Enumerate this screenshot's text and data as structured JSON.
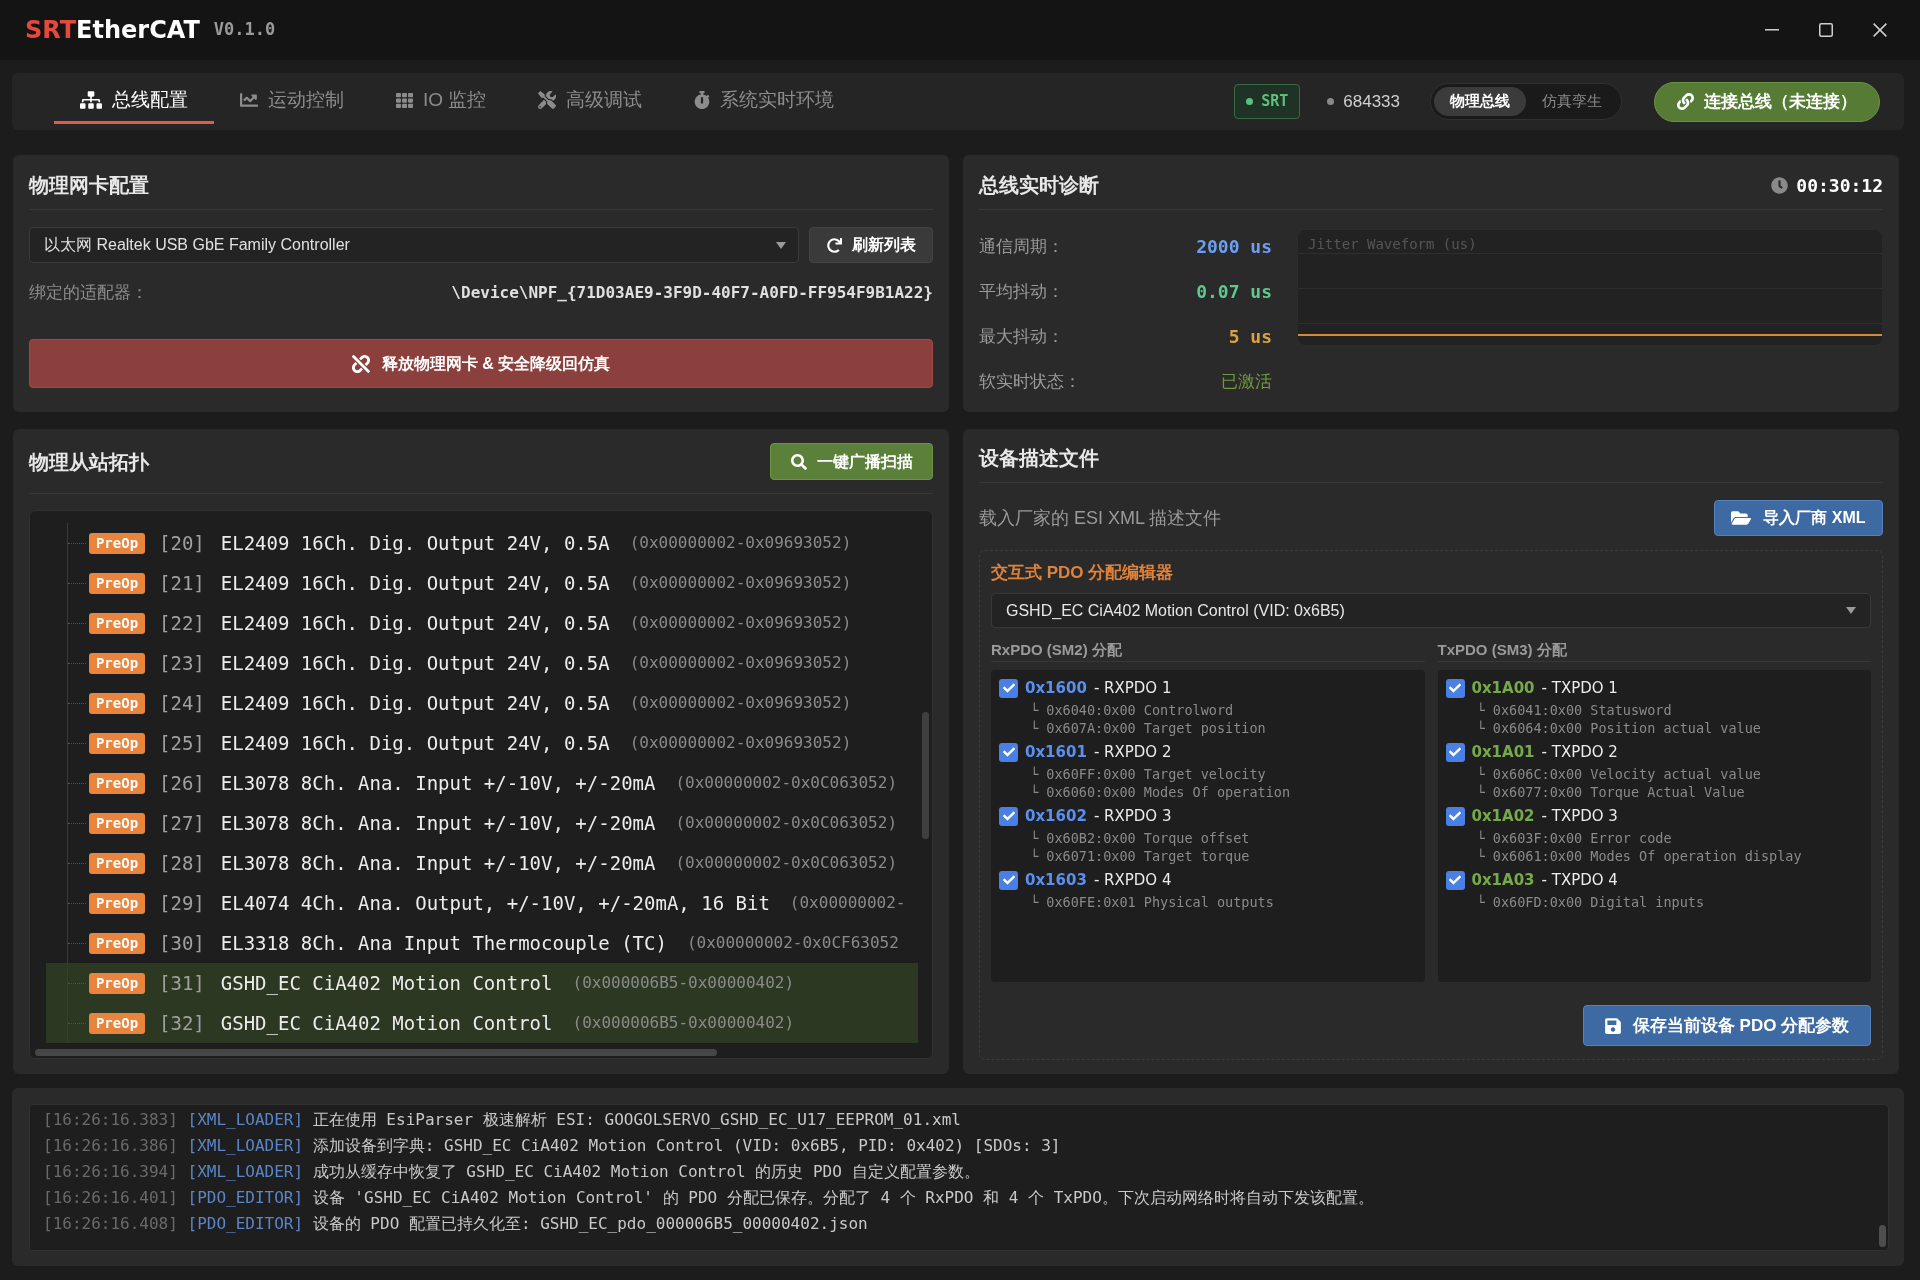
{
  "window": {
    "logo": {
      "accent": "SRT",
      "text": "EtherCAT"
    },
    "version": "V0.1.0"
  },
  "nav": {
    "tabs": [
      {
        "label": "总线配置",
        "selected": true
      },
      {
        "label": "运动控制",
        "selected": false
      },
      {
        "label": "IO 监控",
        "selected": false
      },
      {
        "label": "高级调试",
        "selected": false
      },
      {
        "label": "系统实时环境",
        "selected": false
      }
    ],
    "status_badge": "SRT",
    "counter": "684333",
    "mode_toggle": [
      {
        "label": "物理总线",
        "selected": true
      },
      {
        "label": "仿真孪生",
        "selected": false
      }
    ],
    "connect_button": "连接总线（未连接）"
  },
  "nic_panel": {
    "title": "物理网卡配置",
    "adapter_select": {
      "value": "以太网 Realtek USB GbE Family Controller"
    },
    "refresh_button": "刷新列表",
    "bound_label": "绑定的适配器：",
    "bound_value": "\\Device\\NPF_{71D03AE9-3F9D-40F7-A0FD-FF954F9B1A22}",
    "release_button": "释放物理网卡 & 安全降级回仿真"
  },
  "diagnostics": {
    "title": "总线实时诊断",
    "uptime": "00:30:12",
    "metrics": [
      {
        "label": "通信周期：",
        "value": "2000 us",
        "color": "#6c9ff2",
        "kind": "reading"
      },
      {
        "label": "平均抖动：",
        "value": "0.07 us",
        "color": "#5ec98e",
        "kind": "reading"
      },
      {
        "label": "最大抖动：",
        "value": "5 us",
        "color": "#d9a343",
        "kind": "reading"
      },
      {
        "label": "软实时状态：",
        "value": "已激活",
        "color": "#6f9b3d",
        "kind": "status"
      }
    ],
    "waveform_title": "Jitter Waveform (us)"
  },
  "topology": {
    "title": "物理从站拓扑",
    "scan_button": "一键广播扫描",
    "slaves": [
      {
        "state": "PreOp",
        "index": "[20]",
        "name": "EL2409 16Ch. Dig. Output 24V, 0.5A",
        "id": "(0x00000002-0x09693052)",
        "selected": false
      },
      {
        "state": "PreOp",
        "index": "[21]",
        "name": "EL2409 16Ch. Dig. Output 24V, 0.5A",
        "id": "(0x00000002-0x09693052)",
        "selected": false
      },
      {
        "state": "PreOp",
        "index": "[22]",
        "name": "EL2409 16Ch. Dig. Output 24V, 0.5A",
        "id": "(0x00000002-0x09693052)",
        "selected": false
      },
      {
        "state": "PreOp",
        "index": "[23]",
        "name": "EL2409 16Ch. Dig. Output 24V, 0.5A",
        "id": "(0x00000002-0x09693052)",
        "selected": false
      },
      {
        "state": "PreOp",
        "index": "[24]",
        "name": "EL2409 16Ch. Dig. Output 24V, 0.5A",
        "id": "(0x00000002-0x09693052)",
        "selected": false
      },
      {
        "state": "PreOp",
        "index": "[25]",
        "name": "EL2409 16Ch. Dig. Output 24V, 0.5A",
        "id": "(0x00000002-0x09693052)",
        "selected": false
      },
      {
        "state": "PreOp",
        "index": "[26]",
        "name": "EL3078 8Ch. Ana. Input +/-10V, +/-20mA",
        "id": "(0x00000002-0x0C063052)",
        "selected": false
      },
      {
        "state": "PreOp",
        "index": "[27]",
        "name": "EL3078 8Ch. Ana. Input +/-10V, +/-20mA",
        "id": "(0x00000002-0x0C063052)",
        "selected": false
      },
      {
        "state": "PreOp",
        "index": "[28]",
        "name": "EL3078 8Ch. Ana. Input +/-10V, +/-20mA",
        "id": "(0x00000002-0x0C063052)",
        "selected": false
      },
      {
        "state": "PreOp",
        "index": "[29]",
        "name": "EL4074 4Ch. Ana. Output, +/-10V, +/-20mA, 16 Bit",
        "id": "(0x00000002-",
        "selected": false
      },
      {
        "state": "PreOp",
        "index": "[30]",
        "name": "EL3318 8Ch. Ana Input Thermocouple (TC)",
        "id": "(0x00000002-0x0CF63052",
        "selected": false
      },
      {
        "state": "PreOp",
        "index": "[31]",
        "name": "GSHD_EC CiA402 Motion Control",
        "id": "(0x000006B5-0x00000402)",
        "selected": true
      },
      {
        "state": "PreOp",
        "index": "[32]",
        "name": "GSHD_EC CiA402 Motion Control",
        "id": "(0x000006B5-0x00000402)",
        "selected": true
      }
    ]
  },
  "esi_panel": {
    "title": "设备描述文件",
    "hint": "载入厂家的 ESI XML 描述文件",
    "import_button": "导入厂商 XML",
    "editor": {
      "title": "交互式 PDO 分配编辑器",
      "device_select": {
        "value": "GSHD_EC CiA402 Motion Control (VID: 0x6B5)"
      },
      "groups": [
        {
          "title": "RxPDO (SM2) 分配",
          "kind": "rx",
          "pdos": [
            {
              "index": "0x1600",
              "name": "- RXPDO 1",
              "checked": true,
              "entries": [
                "└ 0x6040:0x00 Controlword",
                "└ 0x607A:0x00 Target position"
              ]
            },
            {
              "index": "0x1601",
              "name": "- RXPDO 2",
              "checked": true,
              "entries": [
                "└ 0x60FF:0x00 Target velocity",
                "└ 0x6060:0x00 Modes Of operation"
              ]
            },
            {
              "index": "0x1602",
              "name": "- RXPDO 3",
              "checked": true,
              "entries": [
                "└ 0x60B2:0x00 Torque offset",
                "└ 0x6071:0x00 Target torque"
              ]
            },
            {
              "index": "0x1603",
              "name": "- RXPDO 4",
              "checked": true,
              "entries": [
                "└ 0x60FE:0x01 Physical outputs"
              ]
            }
          ]
        },
        {
          "title": "TxPDO (SM3) 分配",
          "kind": "tx",
          "pdos": [
            {
              "index": "0x1A00",
              "name": "- TXPDO 1",
              "checked": true,
              "entries": [
                "└ 0x6041:0x00 Statusword",
                "└ 0x6064:0x00 Position actual value"
              ]
            },
            {
              "index": "0x1A01",
              "name": "- TXPDO 2",
              "checked": true,
              "entries": [
                "└ 0x606C:0x00 Velocity actual value",
                "└ 0x6077:0x00 Torque Actual Value"
              ]
            },
            {
              "index": "0x1A02",
              "name": "- TXPDO 3",
              "checked": true,
              "entries": [
                "└ 0x603F:0x00 Error code",
                "└ 0x6061:0x00 Modes Of operation display"
              ]
            },
            {
              "index": "0x1A03",
              "name": "- TXPDO 4",
              "checked": true,
              "entries": [
                "└ 0x60FD:0x00 Digital inputs"
              ]
            }
          ]
        }
      ],
      "save_button": "保存当前设备 PDO 分配参数"
    }
  },
  "log": {
    "lines": [
      {
        "time": "[16:26:16.383]",
        "tag": "[XML_LOADER]",
        "message": "正在使用 EsiParser 极速解析 ESI: GOOGOLSERVO_GSHD_EC_U17_EEPROM_01.xml"
      },
      {
        "time": "[16:26:16.386]",
        "tag": "[XML_LOADER]",
        "message": "添加设备到字典: GSHD_EC CiA402 Motion Control (VID: 0x6B5, PID: 0x402) [SDOs: 3]"
      },
      {
        "time": "[16:26:16.394]",
        "tag": "[XML_LOADER]",
        "message": "成功从缓存中恢复了 GSHD_EC CiA402 Motion Control 的历史 PDO 自定义配置参数。"
      },
      {
        "time": "[16:26:16.401]",
        "tag": "[PDO_EDITOR]",
        "message": "设备 'GSHD_EC CiA402 Motion Control' 的 PDO 分配已保存。分配了 4 个 RxPDO 和 4 个 TxPDO。下次启动网络时将自动下发该配置。"
      },
      {
        "time": "[16:26:16.408]",
        "tag": "[PDO_EDITOR]",
        "message": "设备的 PDO 配置已持久化至: GSHD_EC_pdo_000006B5_00000402.json"
      }
    ]
  }
}
